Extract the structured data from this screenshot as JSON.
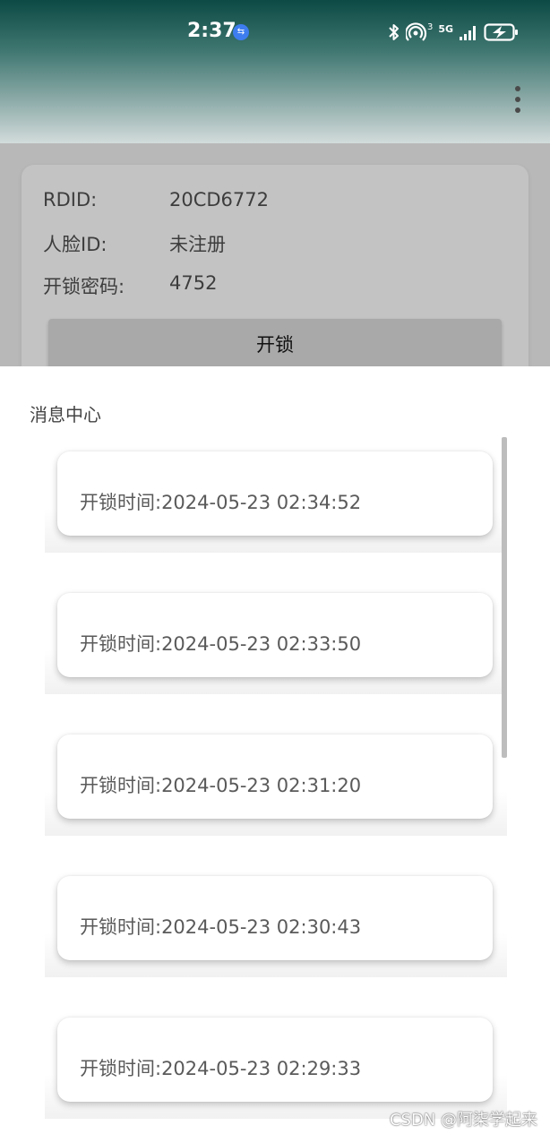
{
  "status_bar": {
    "time": "2:37",
    "usb_icon": "usb-icon",
    "icons": [
      "bluetooth-icon",
      "hotspot-icon",
      "signal-5g-icon",
      "battery-charging-icon"
    ],
    "hotspot_badge": "3",
    "network_label": "5G"
  },
  "app_bar": {
    "menu_icon": "more-vert-icon"
  },
  "device_info": {
    "rdid_label": "RDID:",
    "rdid_value": "20CD6772",
    "face_label": "人脸ID:",
    "face_value": "未注册",
    "password_label": "开锁密码:",
    "password_value": "4752",
    "unlock_label": "开锁"
  },
  "message_center": {
    "title": "消息中心",
    "items": [
      {
        "text": "开锁时间:2024-05-23 02:34:52"
      },
      {
        "text": "开锁时间:2024-05-23 02:33:50"
      },
      {
        "text": "开锁时间:2024-05-23 02:31:20"
      },
      {
        "text": "开锁时间:2024-05-23 02:30:43"
      },
      {
        "text": "开锁时间:2024-05-23 02:29:33"
      }
    ]
  },
  "watermark": "CSDN @阿柒学起来"
}
